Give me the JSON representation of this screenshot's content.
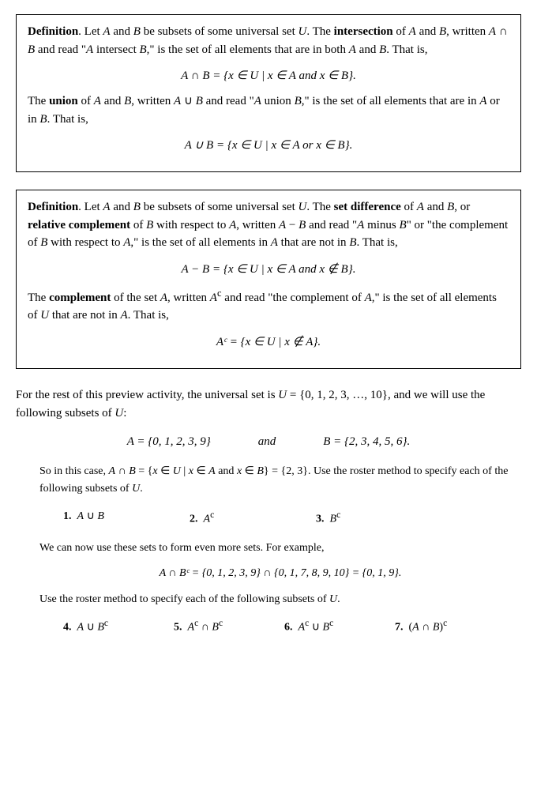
{
  "def1": {
    "intro": "Definition. Let A and B be subsets of some universal set U. The intersection of A and B, written A ∩ B and read \"A intersect B,\" is the set of all elements that are in both A and B. That is,",
    "formula1": "A ∩ B = {x ∈ U | x ∈ A and x ∈ B}.",
    "union_text": "The union of A and B, written A ∪ B and read \"A union B,\" is the set of all elements that are in A or in B. That is,",
    "formula2": "A ∪ B = {x ∈ U | x ∈ A or x ∈ B}."
  },
  "def2": {
    "intro": "Definition. Let A and B be subsets of some universal set U. The set difference of A and B, or relative complement of B with respect to A, written A − B and read \"A minus B\" or \"the complement of B with respect to A,\" is the set of all elements in A that are not in B. That is,",
    "formula1": "A − B = {x ∈ U | x ∈ A and x ∉ B}.",
    "complement_text": "The complement of the set A, written Aᶜ and read \"the complement of A,\" is the set of all elements of U that are not in A. That is,",
    "formula2": "Aᶜ = {x ∈ U | x ∉ A}."
  },
  "prose1": {
    "text": "For the rest of this preview activity, the universal set is U = {0, 1, 2, 3, …, 10}, and we will use the following subsets of U:"
  },
  "sets_display": {
    "A": "A = {0, 1, 2, 3, 9}",
    "and": "and",
    "B": "B = {2, 3, 4, 5, 6}."
  },
  "indent1": {
    "text": "So in this case, A ∩ B = {x ∈ U | x ∈ A and x ∈ B} = {2, 3}. Use the roster method to specify each of the following subsets of U."
  },
  "exercises1": [
    {
      "num": "1.",
      "label": "A ∪ B"
    },
    {
      "num": "2.",
      "label": "Aᶜ"
    },
    {
      "num": "3.",
      "label": "Bᶜ"
    }
  ],
  "indent2": {
    "text": "We can now use these sets to form even more sets. For example,"
  },
  "formula_example": "A ∩ Bᶜ = {0, 1, 2, 3, 9} ∩ {0, 1, 7, 8, 9, 10} = {0, 1, 9}.",
  "indent3": {
    "text": "Use the roster method to specify each of the following subsets of U."
  },
  "exercises2": [
    {
      "num": "4.",
      "label": "A ∪ Bᶜ"
    },
    {
      "num": "5.",
      "label": "Aᶜ ∩ Bᶜ"
    },
    {
      "num": "6.",
      "label": "Aᶜ ∪ Bᶜ"
    },
    {
      "num": "7.",
      "label": "(A ∩ B)ᶜ"
    }
  ]
}
